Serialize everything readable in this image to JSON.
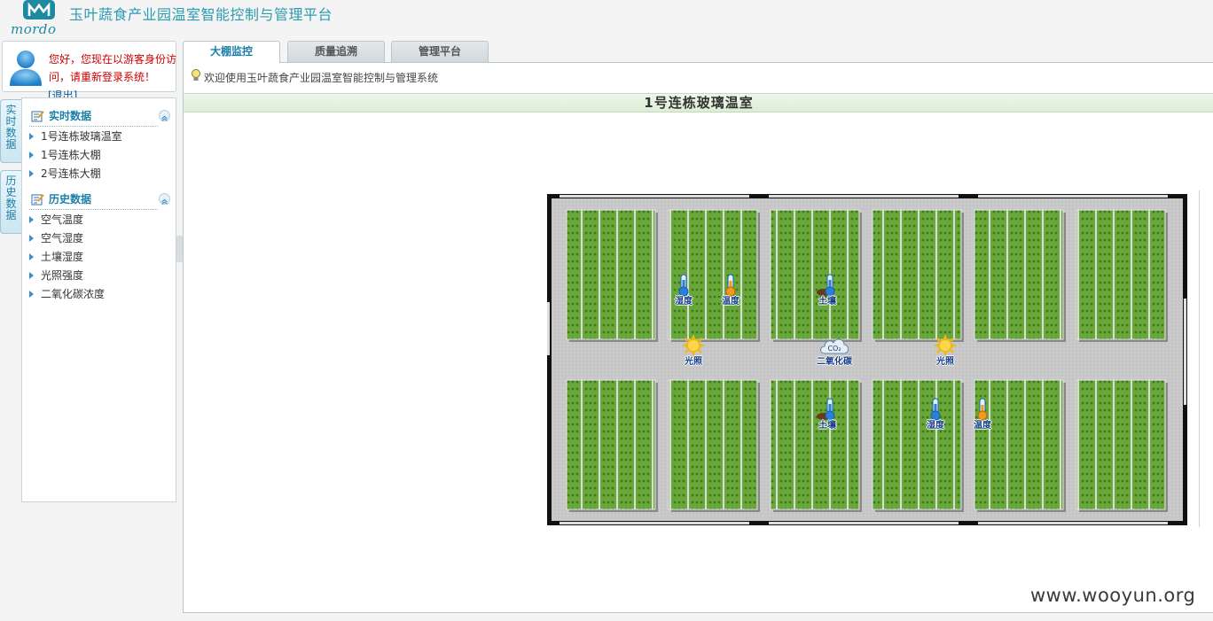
{
  "header": {
    "logo_text": "mordo",
    "app_title": "玉叶蔬食产业园温室智能控制与管理平台"
  },
  "user": {
    "message": "您好，您现在以游客身份访问，请重新登录系统！",
    "logout": "[退出]"
  },
  "vertical_tabs": [
    "实时数据",
    "历史数据"
  ],
  "sidebar": {
    "realtime_title": "实时数据",
    "realtime_items": [
      "1号连栋玻璃温室",
      "1号连栋大棚",
      "2号连栋大棚"
    ],
    "history_title": "历史数据",
    "history_items": [
      "空气温度",
      "空气湿度",
      "土壤湿度",
      "光照强度",
      "二氧化碳浓度"
    ]
  },
  "tabs": [
    "大棚监控",
    "质量追溯",
    "管理平台"
  ],
  "active_tab": "大棚监控",
  "welcome": "欢迎使用玉叶蔬食产业园温室智能控制与管理系统",
  "section_title": "1号连栋玻璃温室",
  "sensors": [
    {
      "type": "humidity",
      "label": "湿度",
      "icon": "thermometer-blue-icon"
    },
    {
      "type": "temperature",
      "label": "温度",
      "icon": "thermometer-orange-icon"
    },
    {
      "type": "soil",
      "label": "土壤",
      "icon": "soil-sensor-icon"
    },
    {
      "type": "light",
      "label": "光照",
      "icon": "sun-icon"
    },
    {
      "type": "co2",
      "label": "二氧化碳",
      "icon": "co2-cloud-icon",
      "badge": "CO₂"
    },
    {
      "type": "light",
      "label": "光照",
      "icon": "sun-icon"
    },
    {
      "type": "soil",
      "label": "土壤",
      "icon": "soil-sensor-icon"
    },
    {
      "type": "humidity",
      "label": "湿度",
      "icon": "thermometer-blue-icon"
    },
    {
      "type": "temperature",
      "label": "温度",
      "icon": "thermometer-orange-icon"
    }
  ],
  "watermark": "www.wooyun.org",
  "colors": {
    "accent": "#1b7fa8",
    "title": "#2a9bb0",
    "warning_text": "#cc0000",
    "plant_green": "#5a9a2c",
    "floor_gray": "#c8c8c8"
  }
}
